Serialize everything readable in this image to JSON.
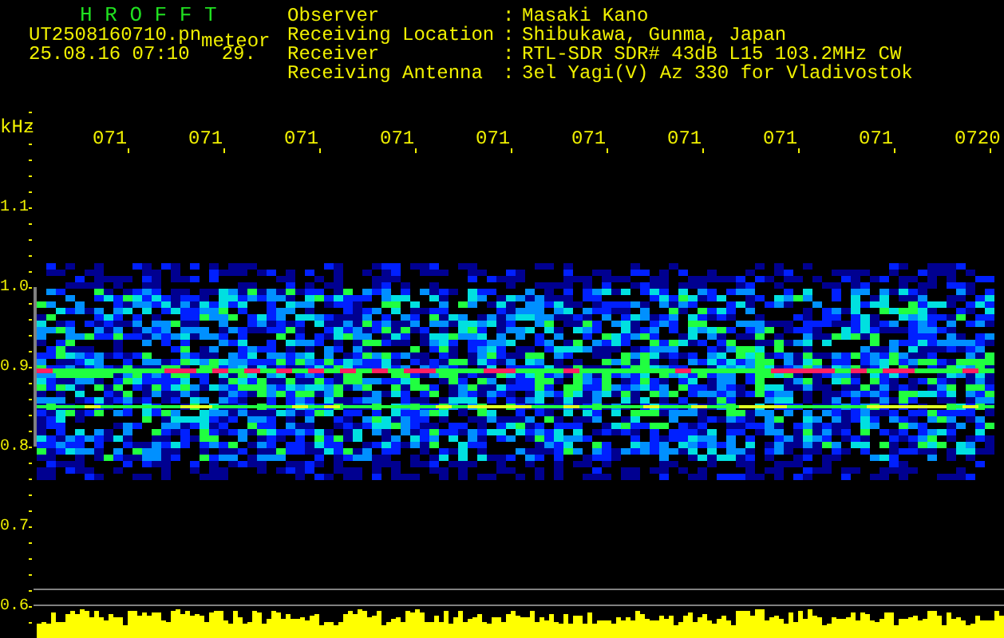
{
  "header": {
    "title": "H R O F F T",
    "filename": "UT2508160710.pn",
    "mode": "meteor",
    "datetime": "25.08.16 07:10",
    "count": "29."
  },
  "info": [
    {
      "label": "Observer",
      "separator": ":",
      "value": "Masaki Kano"
    },
    {
      "label": "Receiving Location",
      "separator": ":",
      "value": "Shibukawa, Gunma, Japan"
    },
    {
      "label": "Receiver",
      "separator": ":",
      "value": "RTL-SDR SDR# 43dB L15 103.2MHz CW"
    },
    {
      "label": "Receiving Antenna",
      "separator": ":",
      "value": "3el Yagi(V) Az 330 for Vladivostok"
    }
  ],
  "plot": {
    "y_unit": "kHz",
    "time_labels": [
      "071",
      "071",
      "071",
      "071",
      "071",
      "071",
      "071",
      "071",
      "071",
      "0720"
    ],
    "freq_labels": [
      "1.1",
      "1.0",
      "0.9",
      "0.8",
      "0.7",
      "0.6"
    ]
  }
}
